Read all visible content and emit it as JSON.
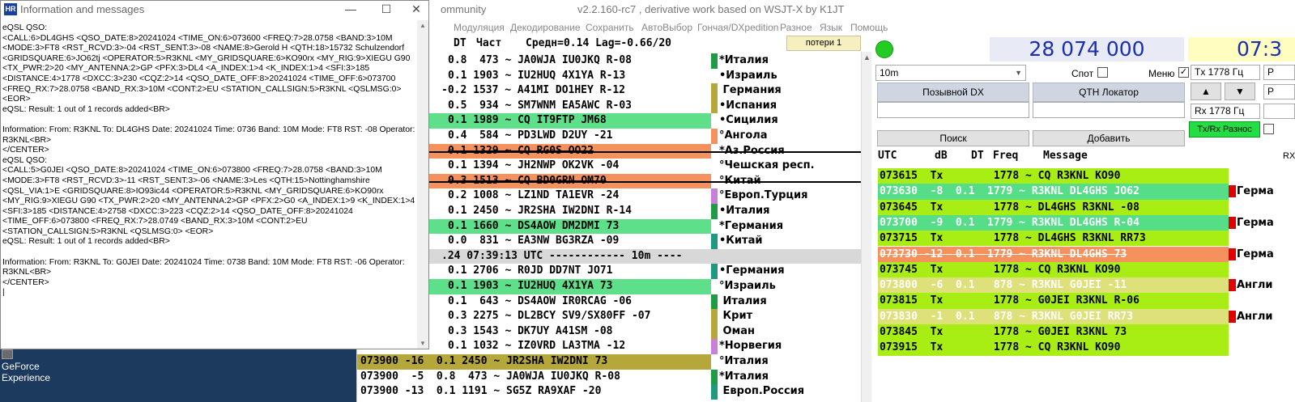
{
  "desktop": {
    "geforce_line1": "GeForce",
    "geforce_line2": "Experience"
  },
  "info_window": {
    "title": "Information and messages",
    "logo_text": "HR",
    "lines": [
      "eQSL QSO:",
      "<CALL:6>DL4GHS <QSO_DATE:8>20241024 <TIME_ON:6>073600 <FREQ:7>28.0758 <BAND:3>10M",
      "<MODE:3>FT8 <RST_RCVD:3>-04 <RST_SENT:3>-08 <NAME:8>Gerold H <QTH:18>15732 Schulzendorf",
      "<GRIDSQUARE:6>JO62tj <OPERATOR:5>R3KNL <MY_GRIDSQUARE:6>KO90rx <MY_RIG:9>XIEGU G90",
      "<TX_PWR:2>20 <MY_ANTENNA:2>GP <PFX:3>DL4 <A_INDEX:1>4 <K_INDEX:1>4 <SFI:3>185",
      "<DISTANCE:4>1778 <DXCC:3>230 <CQZ:2>14 <QSO_DATE_OFF:8>20241024 <TIME_OFF:6>073700",
      "<FREQ_RX:7>28.0758 <BAND_RX:3>10M <CONT:2>EU <STATION_CALLSIGN:5>R3KNL <QSLMSG:0>",
      "<EOR>",
      "eQSL: Result: 1 out of 1 records added<BR>",
      "",
      " Information: From: R3KNL To: DL4GHS Date: 20241024 Time: 0736 Band: 10M Mode: FT8 RST: -08 Operator:",
      "R3KNL<BR>",
      "</CENTER>",
      "eQSL QSO:",
      "<CALL:5>G0JEI <QSO_DATE:8>20241024 <TIME_ON:6>073800 <FREQ:7>28.0758 <BAND:3>10M",
      "<MODE:3>FT8 <RST_RCVD:3>-11 <RST_SENT:3>-06 <NAME:3>Les <QTH:15>Nottinghamshire",
      "<QSL_VIA:1>E <GRIDSQUARE:8>IO93ic44 <OPERATOR:5>R3KNL <MY_GRIDSQUARE:6>KO90rx",
      "<MY_RIG:9>XIEGU G90 <TX_PWR:2>20 <MY_ANTENNA:2>GP <PFX:2>G0 <A_INDEX:1>9 <K_INDEX:1>4",
      "<SFI:3>185 <DISTANCE:4>2758 <DXCC:3>223 <CQZ:2>14 <QSO_DATE_OFF:8>20241024",
      "<TIME_OFF:6>073800 <FREQ_RX:7>28.0749 <BAND_RX:3>10M <CONT:2>EU",
      "<STATION_CALLSIGN:5>R3KNL <QSLMSG:0> <EOR>",
      "eQSL: Result: 1 out of 1 records added<BR>",
      "",
      " Information: From: R3KNL To: G0JEI Date: 20241024 Time: 0738 Band: 10M Mode: FT8 RST: -06 Operator:",
      "R3KNL<BR>",
      "</CENTER>",
      "|"
    ]
  },
  "main_window": {
    "title_fragment": "ommunity",
    "title_version": "v2.2.160-rc7 , derivative work based on WSJT-X by K1JT",
    "menu": [
      "Модуляция",
      "Декодирование",
      "Сохранить",
      "АвтоВыбор",
      "Гончая/DXpedition",
      "Разное",
      "Язык",
      "Помощь"
    ]
  },
  "band_activity": {
    "header": {
      "dt": "DT",
      "freq": "Част",
      "stats": "Средн=0.14 Lag=-0.66/20",
      "loss": "потери 1"
    },
    "colors": {
      "green": "#5ee08a",
      "orange": "#f4915c",
      "olive": "#b5a73a",
      "gray": "#d8d8d8"
    },
    "rows": [
      {
        "text": "0.8  473 ~ JA0WJA IU0JKQ R-08",
        "country": "*Италия",
        "bg": "",
        "flag": "#1f9a45",
        "strike": false
      },
      {
        "text": "0.1 1903 ~ IU2HUQ 4X1YA R-13",
        "country": "•Израиль",
        "bg": "",
        "flag": "",
        "strike": false
      },
      {
        "text": "-0.2 1537 ~ A41MI DO1HEY R-12",
        "country": " Германия",
        "bg": "",
        "flag": "#b5a73a",
        "strike": false
      },
      {
        "text": "0.5  934 ~ SM7WNM EA5AWC R-03",
        "country": "•Испания",
        "bg": "",
        "flag": "#b5a73a",
        "strike": false
      },
      {
        "text": "0.1 1989 ~ CQ IT9FTP JM68",
        "country": "•Сицилия",
        "bg": "#5ee08a",
        "flag": "",
        "strike": false
      },
      {
        "text": "0.4  584 ~ PD3LWD D2UY -21",
        "country": "°Ангола",
        "bg": "",
        "flag": "#f4915c",
        "strike": false
      },
      {
        "text": "0.1 1329 ~ CQ RG0S OO22",
        "country": "*Аз.Россия",
        "bg": "#f4915c",
        "flag": "",
        "strike": true
      },
      {
        "text": "0.1 1394 ~ JH2NWP OK2VK -04",
        "country": "°Чешская респ.",
        "bg": "",
        "flag": "",
        "strike": false
      },
      {
        "text": "0.3 1513 ~ CQ BD0GRN OM70",
        "country": "°Китай",
        "bg": "#f4915c",
        "flag": "",
        "strike": true
      },
      {
        "text": "0.2 1008 ~ LZ1ND TA1EVR -24",
        "country": "°Европ.Турция",
        "bg": "",
        "flag": "#c980d8",
        "strike": false
      },
      {
        "text": "0.1 2450 ~ JR2SHA IW2DNI R-14",
        "country": "•Италия",
        "bg": "",
        "flag": "#1f9a45",
        "strike": false
      },
      {
        "text": "0.1 1660 ~ DS4AOW DM2DMI 73",
        "country": "*Германия",
        "bg": "#5ee08a",
        "flag": "",
        "strike": false
      },
      {
        "text": "0.0  831 ~ EA3NW BG3RZA -09",
        "country": "•Китай",
        "bg": "",
        "flag": "#1f9a80",
        "strike": false
      },
      {
        "text": ".24 07:39:13 UTC ------------ 10m ----",
        "country": "",
        "bg": "#d8d8d8",
        "flag": "",
        "strike": false,
        "separator": true
      },
      {
        "text": "0.1 2706 ~ R0JD DD7NT JO71",
        "country": "•Германия",
        "bg": "",
        "flag": "#1f9a80",
        "strike": false
      },
      {
        "text": "0.1 1903 ~ IU2HUQ 4X1YA 73",
        "country": "°Израиль",
        "bg": "#5ee08a",
        "flag": "",
        "strike": false
      },
      {
        "text": "0.1  643 ~ DS4AOW IR0RCAG -06",
        "country": " Италия",
        "bg": "",
        "flag": "#1f9a45",
        "strike": false
      },
      {
        "text": "0.3 2275 ~ DL2BCY SV9/SX80FF -07",
        "country": " Крит",
        "bg": "",
        "flag": "#b5a73a",
        "strike": false
      },
      {
        "text": "0.3 1543 ~ DK7UY A41SM -08",
        "country": " Оман",
        "bg": "",
        "flag": "#b5a73a",
        "strike": false
      },
      {
        "text": "0.1 1032 ~ IZ0VRD LA3TMA -12",
        "country": "*Норвегия",
        "bg": "",
        "flag": "#c980d8",
        "strike": false
      },
      {
        "text": "073900 -16  0.1 2450 ~ JR2SHA IW2DNI 73",
        "country": "°Италия",
        "bg": "#b5a73a",
        "flag": "",
        "strike": false,
        "full": true
      },
      {
        "text": "073900  -5  0.8  473 ~ JA0WJA IU0JKQ R-08",
        "country": "*Италия",
        "bg": "",
        "flag": "#1f9a45",
        "strike": false,
        "full": true
      },
      {
        "text": "073900 -13  0.1 1191 ~ SG5Z RA9XAF -20",
        "country": " Европ.Россия",
        "bg": "",
        "flag": "#1f9a80",
        "strike": false,
        "full": true
      }
    ]
  },
  "controls": {
    "frequency": "28 074 000",
    "time": "07:3",
    "band": "10m",
    "spot_label": "Спот",
    "menu_label": "Меню",
    "menu_checked": "✓",
    "tx_spin": "Tx  1778  Гц",
    "rx_spin": "Rx  1778  Гц",
    "dx_call_label": "Позывной DX",
    "qth_label": "QTH Локатор",
    "search_label": "Поиск",
    "add_label": "Добавить",
    "txrx_label": "Tx/Rx Разнос",
    "up_arrow": "▲",
    "down_arrow": "▼",
    "side_label_1": "P",
    "side_label_2": "P",
    "rx_cut_label": "RX"
  },
  "rx_list": {
    "headers": {
      "utc": "UTC",
      "db": "dB",
      "dt": "DT",
      "freq": "Freq",
      "message": "Message"
    },
    "rows": [
      {
        "text": "073615  Tx        1778 ~ CQ R3KNL KO90",
        "bg": "#a8ee15",
        "color": "#000",
        "strike": false,
        "country": "",
        "flag": false
      },
      {
        "text": "073630  -8  0.1  1779 ~ R3KNL DL4GHS JO62",
        "bg": "#55dd88",
        "color": "#fff",
        "strike": false,
        "country": "Герма",
        "flag": true
      },
      {
        "text": "073645  Tx        1778 ~ DL4GHS R3KNL -08",
        "bg": "#a8ee15",
        "color": "#000",
        "strike": false,
        "country": "",
        "flag": false
      },
      {
        "text": "073700  -9  0.1  1779 ~ R3KNL DL4GHS R-04",
        "bg": "#55dd88",
        "color": "#fff",
        "strike": false,
        "country": "Герма",
        "flag": true
      },
      {
        "text": "073715  Tx        1778 ~ DL4GHS R3KNL RR73",
        "bg": "#a8ee15",
        "color": "#000",
        "strike": false,
        "country": "",
        "flag": false
      },
      {
        "text": "073730 -12  0.1  1779 ~ R3KNL DL4GHS 73",
        "bg": "#f4915c",
        "color": "#fff",
        "strike": true,
        "country": "Герма",
        "flag": true
      },
      {
        "text": "073745  Tx        1778 ~ CQ R3KNL KO90",
        "bg": "#a8ee15",
        "color": "#000",
        "strike": false,
        "country": "",
        "flag": false
      },
      {
        "text": "073800  -6  0.1   878 ~ R3KNL G0JEI -11",
        "bg": "#dee07a",
        "color": "#fff",
        "strike": false,
        "country": "Англи",
        "flag": true
      },
      {
        "text": "073815  Tx        1778 ~ G0JEI R3KNL R-06",
        "bg": "#a8ee15",
        "color": "#000",
        "strike": false,
        "country": "",
        "flag": false
      },
      {
        "text": "073830  -1  0.1   878 ~ R3KNL G0JEI RR73",
        "bg": "#dee07a",
        "color": "#fff",
        "strike": false,
        "country": "Англи",
        "flag": true
      },
      {
        "text": "073845  Tx        1778 ~ G0JEI R3KNL 73",
        "bg": "#a8ee15",
        "color": "#000",
        "strike": false,
        "country": "",
        "flag": false
      },
      {
        "text": "073915  Tx        1778 ~ CQ R3KNL KO90",
        "bg": "#a8ee15",
        "color": "#000",
        "strike": false,
        "country": "",
        "flag": false
      }
    ]
  }
}
